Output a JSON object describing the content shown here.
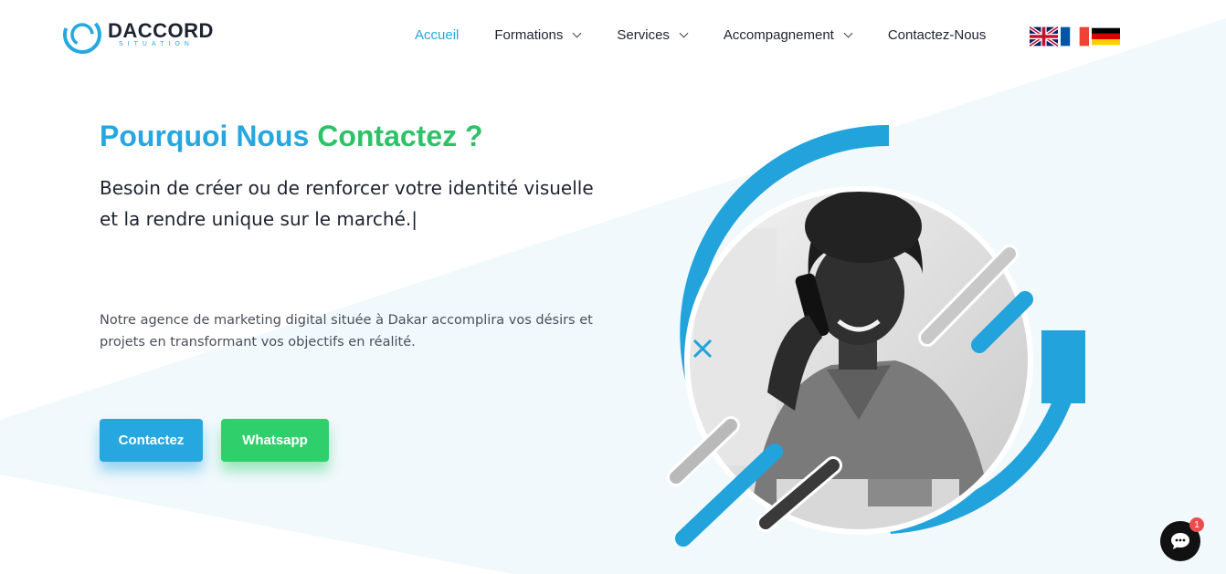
{
  "brand": {
    "name": "DACCORD",
    "subtitle": "SITUATION",
    "primary_color": "#27a7df",
    "accent_color": "#2ec268",
    "dark_color": "#1d2330"
  },
  "nav": {
    "items": [
      {
        "label": "Accueil",
        "active": true,
        "has_dropdown": false
      },
      {
        "label": "Formations",
        "active": false,
        "has_dropdown": true
      },
      {
        "label": "Services",
        "active": false,
        "has_dropdown": true
      },
      {
        "label": "Accompagnement",
        "active": false,
        "has_dropdown": true
      },
      {
        "label": "Contactez-Nous",
        "active": false,
        "has_dropdown": false
      }
    ],
    "languages": [
      {
        "icon": "uk-flag-icon"
      },
      {
        "icon": "france-flag-icon"
      },
      {
        "icon": "germany-flag-icon"
      }
    ]
  },
  "hero": {
    "title_part1": "Pourquoi Nous",
    "title_part2": "Contactez ?",
    "lead": "Besoin de créer ou de renforcer votre identité visuelle et la rendre unique sur le marché.",
    "cursor": "|",
    "description": "Notre agence de marketing digital située à Dakar accomplira vos désirs et projets en transformant vos objectifs en réalité.",
    "buttons": {
      "contact_label": "Contactez",
      "whatsapp_label": "Whatsapp"
    },
    "image_icon": "woman-on-phone-photo"
  },
  "chat": {
    "icon": "chat-bubble-icon",
    "badge_count": "1"
  }
}
